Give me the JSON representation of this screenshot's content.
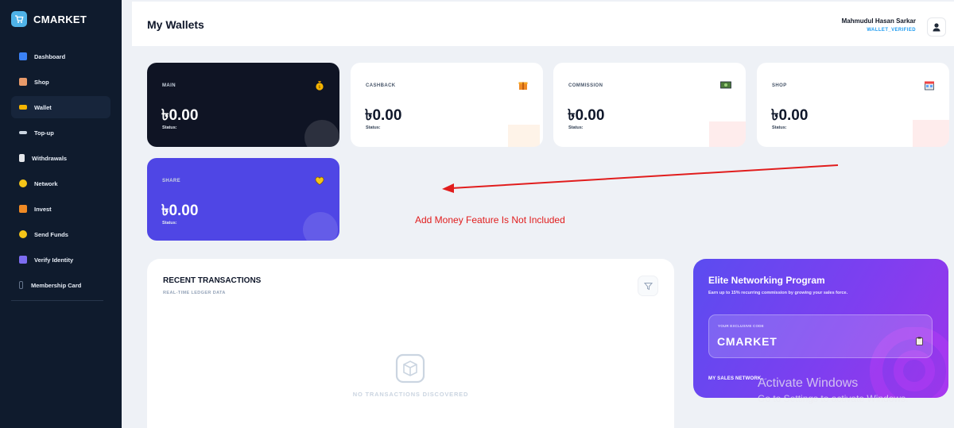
{
  "brand": {
    "name": "CMARKET"
  },
  "sidebar": {
    "items": [
      {
        "label": "Dashboard",
        "icon": "bar-chart-icon",
        "color": "#3b82f6",
        "active": false
      },
      {
        "label": "Shop",
        "icon": "shop-bag-icon",
        "color": "#e89a6a",
        "active": false
      },
      {
        "label": "Wallet",
        "icon": "wallet-icon",
        "color": "#f5b400",
        "active": true
      },
      {
        "label": "Top-up",
        "icon": "top-up-icon",
        "color": "#cbd5e1",
        "active": false
      },
      {
        "label": "Withdrawals",
        "icon": "withdraw-icon",
        "color": "#e5e7eb",
        "active": false
      },
      {
        "label": "Network",
        "icon": "handshake-icon",
        "color": "#f5c518",
        "active": false
      },
      {
        "label": "Invest",
        "icon": "invest-icon",
        "color": "#f08a24",
        "active": false
      },
      {
        "label": "Send Funds",
        "icon": "send-funds-icon",
        "color": "#f5c518",
        "active": false
      },
      {
        "label": "Verify Identity",
        "icon": "id-card-icon",
        "color": "#7c6cf0",
        "active": false
      },
      {
        "label": "Membership Card",
        "icon": "membership-card-icon",
        "color": "#64748b",
        "active": false
      }
    ]
  },
  "header": {
    "title": "My Wallets",
    "user_name": "Mahmudul Hasan Sarkar",
    "user_status": "WALLET_VERIFIED"
  },
  "wallets": [
    {
      "label": "MAIN",
      "amount": "৳0.00",
      "status": "Status:",
      "icon": "money-bag-icon",
      "theme": "dark"
    },
    {
      "label": "CASHBACK",
      "amount": "৳0.00",
      "status": "Status:",
      "icon": "gift-icon",
      "theme": "white"
    },
    {
      "label": "COMMISSION",
      "amount": "৳0.00",
      "status": "Status:",
      "icon": "cash-icon",
      "theme": "white"
    },
    {
      "label": "SHOP",
      "amount": "৳0.00",
      "status": "Status:",
      "icon": "store-icon",
      "theme": "white"
    },
    {
      "label": "SHARE",
      "amount": "৳0.00",
      "status": "Status:",
      "icon": "heart-hands-icon",
      "theme": "purple"
    }
  ],
  "annotation": {
    "text": "Add Money Feature Is Not Included",
    "color": "#e11d1d"
  },
  "transactions": {
    "title": "RECENT TRANSACTIONS",
    "subtitle": "REAL-TIME LEDGER DATA",
    "empty_text": "NO TRANSACTIONS DISCOVERED",
    "filter_icon": "filter-icon"
  },
  "elite": {
    "title": "Elite Networking Program",
    "subtitle": "Earn up to 15% recurring commission by growing your sales force.",
    "code_label": "YOUR EXCLUSIVE CODE",
    "code": "CMARKET",
    "link_label": "MY SALES NETWORK →"
  },
  "watermark": {
    "title": "Activate Windows",
    "subtitle": "Go to Settings to activate Windows."
  }
}
